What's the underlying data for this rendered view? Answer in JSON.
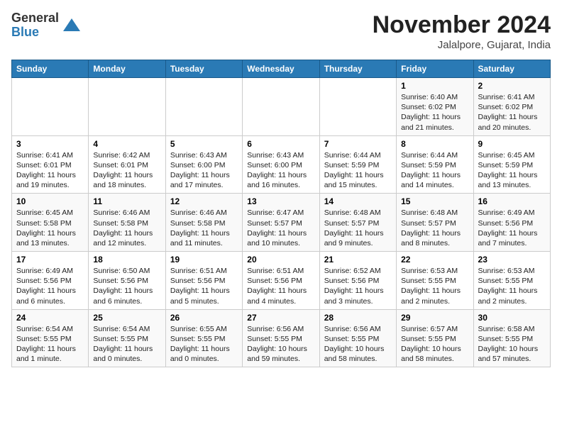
{
  "header": {
    "logo_line1": "General",
    "logo_line2": "Blue",
    "month": "November 2024",
    "location": "Jalalpore, Gujarat, India"
  },
  "weekdays": [
    "Sunday",
    "Monday",
    "Tuesday",
    "Wednesday",
    "Thursday",
    "Friday",
    "Saturday"
  ],
  "weeks": [
    [
      {
        "day": "",
        "info": ""
      },
      {
        "day": "",
        "info": ""
      },
      {
        "day": "",
        "info": ""
      },
      {
        "day": "",
        "info": ""
      },
      {
        "day": "",
        "info": ""
      },
      {
        "day": "1",
        "info": "Sunrise: 6:40 AM\nSunset: 6:02 PM\nDaylight: 11 hours\nand 21 minutes."
      },
      {
        "day": "2",
        "info": "Sunrise: 6:41 AM\nSunset: 6:02 PM\nDaylight: 11 hours\nand 20 minutes."
      }
    ],
    [
      {
        "day": "3",
        "info": "Sunrise: 6:41 AM\nSunset: 6:01 PM\nDaylight: 11 hours\nand 19 minutes."
      },
      {
        "day": "4",
        "info": "Sunrise: 6:42 AM\nSunset: 6:01 PM\nDaylight: 11 hours\nand 18 minutes."
      },
      {
        "day": "5",
        "info": "Sunrise: 6:43 AM\nSunset: 6:00 PM\nDaylight: 11 hours\nand 17 minutes."
      },
      {
        "day": "6",
        "info": "Sunrise: 6:43 AM\nSunset: 6:00 PM\nDaylight: 11 hours\nand 16 minutes."
      },
      {
        "day": "7",
        "info": "Sunrise: 6:44 AM\nSunset: 5:59 PM\nDaylight: 11 hours\nand 15 minutes."
      },
      {
        "day": "8",
        "info": "Sunrise: 6:44 AM\nSunset: 5:59 PM\nDaylight: 11 hours\nand 14 minutes."
      },
      {
        "day": "9",
        "info": "Sunrise: 6:45 AM\nSunset: 5:59 PM\nDaylight: 11 hours\nand 13 minutes."
      }
    ],
    [
      {
        "day": "10",
        "info": "Sunrise: 6:45 AM\nSunset: 5:58 PM\nDaylight: 11 hours\nand 13 minutes."
      },
      {
        "day": "11",
        "info": "Sunrise: 6:46 AM\nSunset: 5:58 PM\nDaylight: 11 hours\nand 12 minutes."
      },
      {
        "day": "12",
        "info": "Sunrise: 6:46 AM\nSunset: 5:58 PM\nDaylight: 11 hours\nand 11 minutes."
      },
      {
        "day": "13",
        "info": "Sunrise: 6:47 AM\nSunset: 5:57 PM\nDaylight: 11 hours\nand 10 minutes."
      },
      {
        "day": "14",
        "info": "Sunrise: 6:48 AM\nSunset: 5:57 PM\nDaylight: 11 hours\nand 9 minutes."
      },
      {
        "day": "15",
        "info": "Sunrise: 6:48 AM\nSunset: 5:57 PM\nDaylight: 11 hours\nand 8 minutes."
      },
      {
        "day": "16",
        "info": "Sunrise: 6:49 AM\nSunset: 5:56 PM\nDaylight: 11 hours\nand 7 minutes."
      }
    ],
    [
      {
        "day": "17",
        "info": "Sunrise: 6:49 AM\nSunset: 5:56 PM\nDaylight: 11 hours\nand 6 minutes."
      },
      {
        "day": "18",
        "info": "Sunrise: 6:50 AM\nSunset: 5:56 PM\nDaylight: 11 hours\nand 6 minutes."
      },
      {
        "day": "19",
        "info": "Sunrise: 6:51 AM\nSunset: 5:56 PM\nDaylight: 11 hours\nand 5 minutes."
      },
      {
        "day": "20",
        "info": "Sunrise: 6:51 AM\nSunset: 5:56 PM\nDaylight: 11 hours\nand 4 minutes."
      },
      {
        "day": "21",
        "info": "Sunrise: 6:52 AM\nSunset: 5:56 PM\nDaylight: 11 hours\nand 3 minutes."
      },
      {
        "day": "22",
        "info": "Sunrise: 6:53 AM\nSunset: 5:55 PM\nDaylight: 11 hours\nand 2 minutes."
      },
      {
        "day": "23",
        "info": "Sunrise: 6:53 AM\nSunset: 5:55 PM\nDaylight: 11 hours\nand 2 minutes."
      }
    ],
    [
      {
        "day": "24",
        "info": "Sunrise: 6:54 AM\nSunset: 5:55 PM\nDaylight: 11 hours\nand 1 minute."
      },
      {
        "day": "25",
        "info": "Sunrise: 6:54 AM\nSunset: 5:55 PM\nDaylight: 11 hours\nand 0 minutes."
      },
      {
        "day": "26",
        "info": "Sunrise: 6:55 AM\nSunset: 5:55 PM\nDaylight: 11 hours\nand 0 minutes."
      },
      {
        "day": "27",
        "info": "Sunrise: 6:56 AM\nSunset: 5:55 PM\nDaylight: 10 hours\nand 59 minutes."
      },
      {
        "day": "28",
        "info": "Sunrise: 6:56 AM\nSunset: 5:55 PM\nDaylight: 10 hours\nand 58 minutes."
      },
      {
        "day": "29",
        "info": "Sunrise: 6:57 AM\nSunset: 5:55 PM\nDaylight: 10 hours\nand 58 minutes."
      },
      {
        "day": "30",
        "info": "Sunrise: 6:58 AM\nSunset: 5:55 PM\nDaylight: 10 hours\nand 57 minutes."
      }
    ]
  ]
}
